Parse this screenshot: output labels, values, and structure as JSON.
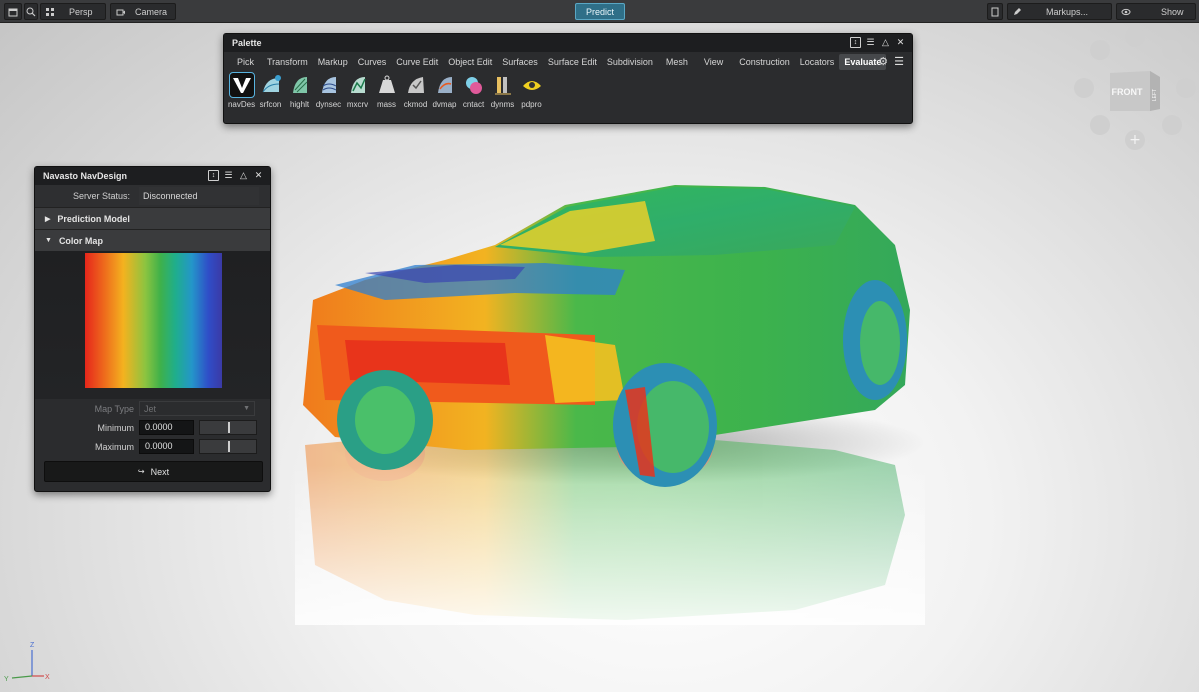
{
  "toolbar": {
    "persp_label": "Persp",
    "camera_label": "Camera",
    "predict_label": "Predict",
    "markups_label": "Markups...",
    "show_label": "Show"
  },
  "palette": {
    "title": "Palette",
    "tabs": [
      "Pick",
      "Transform",
      "Markup",
      "Curves",
      "Curve Edit",
      "Object Edit",
      "Surfaces",
      "Surface Edit",
      "Subdivision",
      "Mesh",
      "View",
      "Construction",
      "Locators",
      "Evaluate"
    ],
    "active_tab": "Evaluate",
    "tools": [
      {
        "label": "navDes",
        "icon": "navdesign-icon",
        "color": "#ffffff"
      },
      {
        "label": "srfcon",
        "icon": "surface-continuity-icon",
        "color": "#9fd3e0"
      },
      {
        "label": "highlt",
        "icon": "highlight-icon",
        "color": "#7fc6a8"
      },
      {
        "label": "dynsec",
        "icon": "dynamic-section-icon",
        "color": "#a8c4e0"
      },
      {
        "label": "mxcrv",
        "icon": "max-curvature-icon",
        "color": "#b8dcd0"
      },
      {
        "label": "mass",
        "icon": "mass-icon",
        "color": "#d8d8d8"
      },
      {
        "label": "ckmod",
        "icon": "check-model-icon",
        "color": "#c8c8c8"
      },
      {
        "label": "dvmap",
        "icon": "deviation-map-icon",
        "color": "#9ab0c8"
      },
      {
        "label": "cntact",
        "icon": "contact-icon",
        "color": "#e05a9a"
      },
      {
        "label": "dynms",
        "icon": "dynamic-measure-icon",
        "color": "#e8c060"
      },
      {
        "label": "pdpro",
        "icon": "part-draft-icon",
        "color": "#f0d020"
      }
    ]
  },
  "navdesign": {
    "title": "Navasto NavDesign",
    "server_status_label": "Server Status:",
    "server_status_value": "Disconnected",
    "prediction_model_label": "Prediction Model",
    "color_map_label": "Color Map",
    "map_type_label": "Map Type",
    "map_type_value": "Jet",
    "minimum_label": "Minimum",
    "minimum_value": "0.0000",
    "maximum_label": "Maximum",
    "maximum_value": "0.0000",
    "next_label": "Next"
  },
  "viewcube": {
    "front_label": "FRONT",
    "left_label": "LEFT"
  },
  "axes": {
    "x": "X",
    "y": "Y",
    "z": "Z"
  }
}
